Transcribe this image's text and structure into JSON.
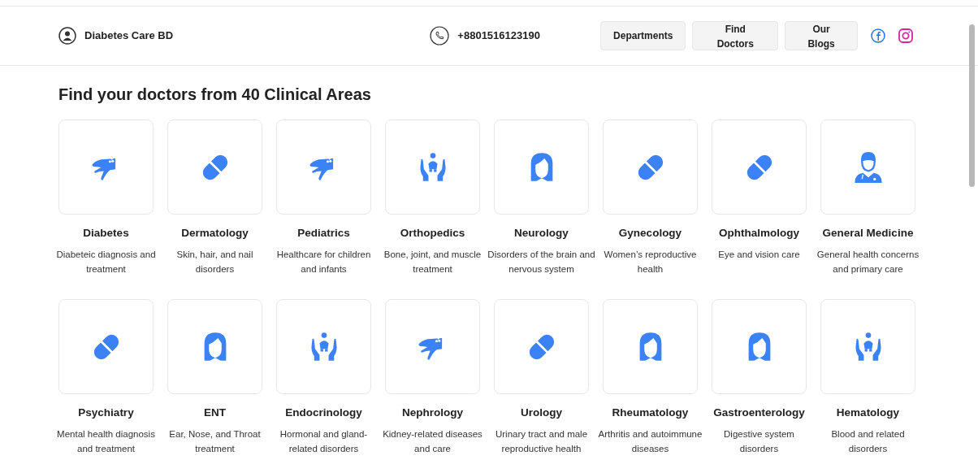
{
  "header": {
    "brand": "Diabetes Care BD",
    "phone": "+8801516123190",
    "nav": [
      "Departments",
      "Find Doctors",
      "Our Blogs"
    ]
  },
  "title": "Find your doctors from 40 Clinical Areas",
  "areas": [
    {
      "name": "Diabetes",
      "description": "Diabeteic diagnosis and treatment",
      "kind": "hand"
    },
    {
      "name": "Dermatology",
      "description": "Skin, hair, and nail disorders",
      "kind": "pill"
    },
    {
      "name": "Pediatrics",
      "description": "Healthcare for children and infants",
      "kind": "hand"
    },
    {
      "name": "Orthopedics",
      "description": "Bone, joint, and muscle treatment",
      "kind": "baby"
    },
    {
      "name": "Neurology",
      "description": "Disorders of the brain and nervous system",
      "kind": "woman"
    },
    {
      "name": "Gynecology",
      "description": "Women’s reproductive health",
      "kind": "pill"
    },
    {
      "name": "Ophthalmology",
      "description": "Eye and vision care",
      "kind": "pill"
    },
    {
      "name": "General Medicine",
      "description": "General health concerns and primary care",
      "kind": "doctor"
    },
    {
      "name": "Psychiatry",
      "description": "Mental health diagnosis and treatment",
      "kind": "pill"
    },
    {
      "name": "ENT",
      "description": "Ear, Nose, and Throat treatment",
      "kind": "woman"
    },
    {
      "name": "Endocrinology",
      "description": "Hormonal and gland-related disorders",
      "kind": "baby"
    },
    {
      "name": "Nephrology",
      "description": "Kidney-related diseases and care",
      "kind": "hand"
    },
    {
      "name": "Urology",
      "description": "Urinary tract and male reproductive health",
      "kind": "pill"
    },
    {
      "name": "Rheumatology",
      "description": "Arthritis and autoimmune diseases",
      "kind": "woman"
    },
    {
      "name": "Gastroenterology",
      "description": "Digestive system disorders",
      "kind": "woman"
    },
    {
      "name": "Hematology",
      "description": "Blood and related disorders",
      "kind": "baby"
    }
  ]
}
